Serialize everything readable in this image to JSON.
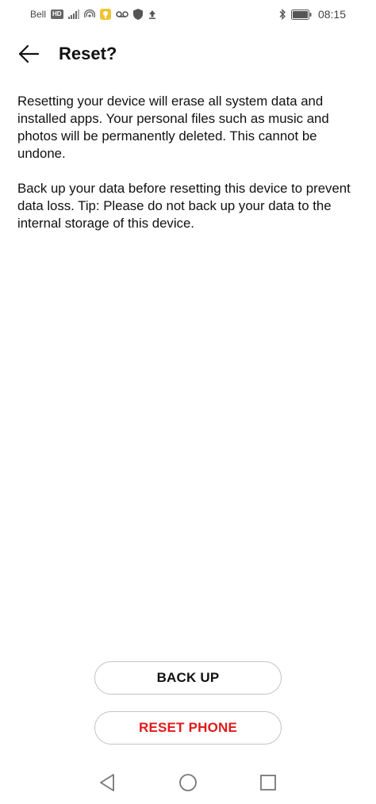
{
  "status_bar": {
    "carrier": "Bell",
    "network_badge": "HD",
    "time": "08:15",
    "icons": [
      "signal-icon",
      "hotspot-icon",
      "notification-icon",
      "voicemail-icon",
      "shield-icon",
      "upload-icon",
      "bluetooth-icon",
      "battery-icon"
    ]
  },
  "header": {
    "title": "Reset?"
  },
  "content": {
    "paragraph1": "Resetting your device will erase all system data and installed apps. Your personal files such as music and photos will be permanently deleted. This cannot be undone.",
    "paragraph2": "Back up your data before resetting this device to prevent data loss. Tip: Please do not back up your data to the internal storage of this device."
  },
  "actions": {
    "backup_label": "BACK UP",
    "reset_label": "RESET PHONE"
  },
  "colors": {
    "danger": "#e11a1a",
    "text": "#111111",
    "button_border": "#c4c4c4"
  }
}
